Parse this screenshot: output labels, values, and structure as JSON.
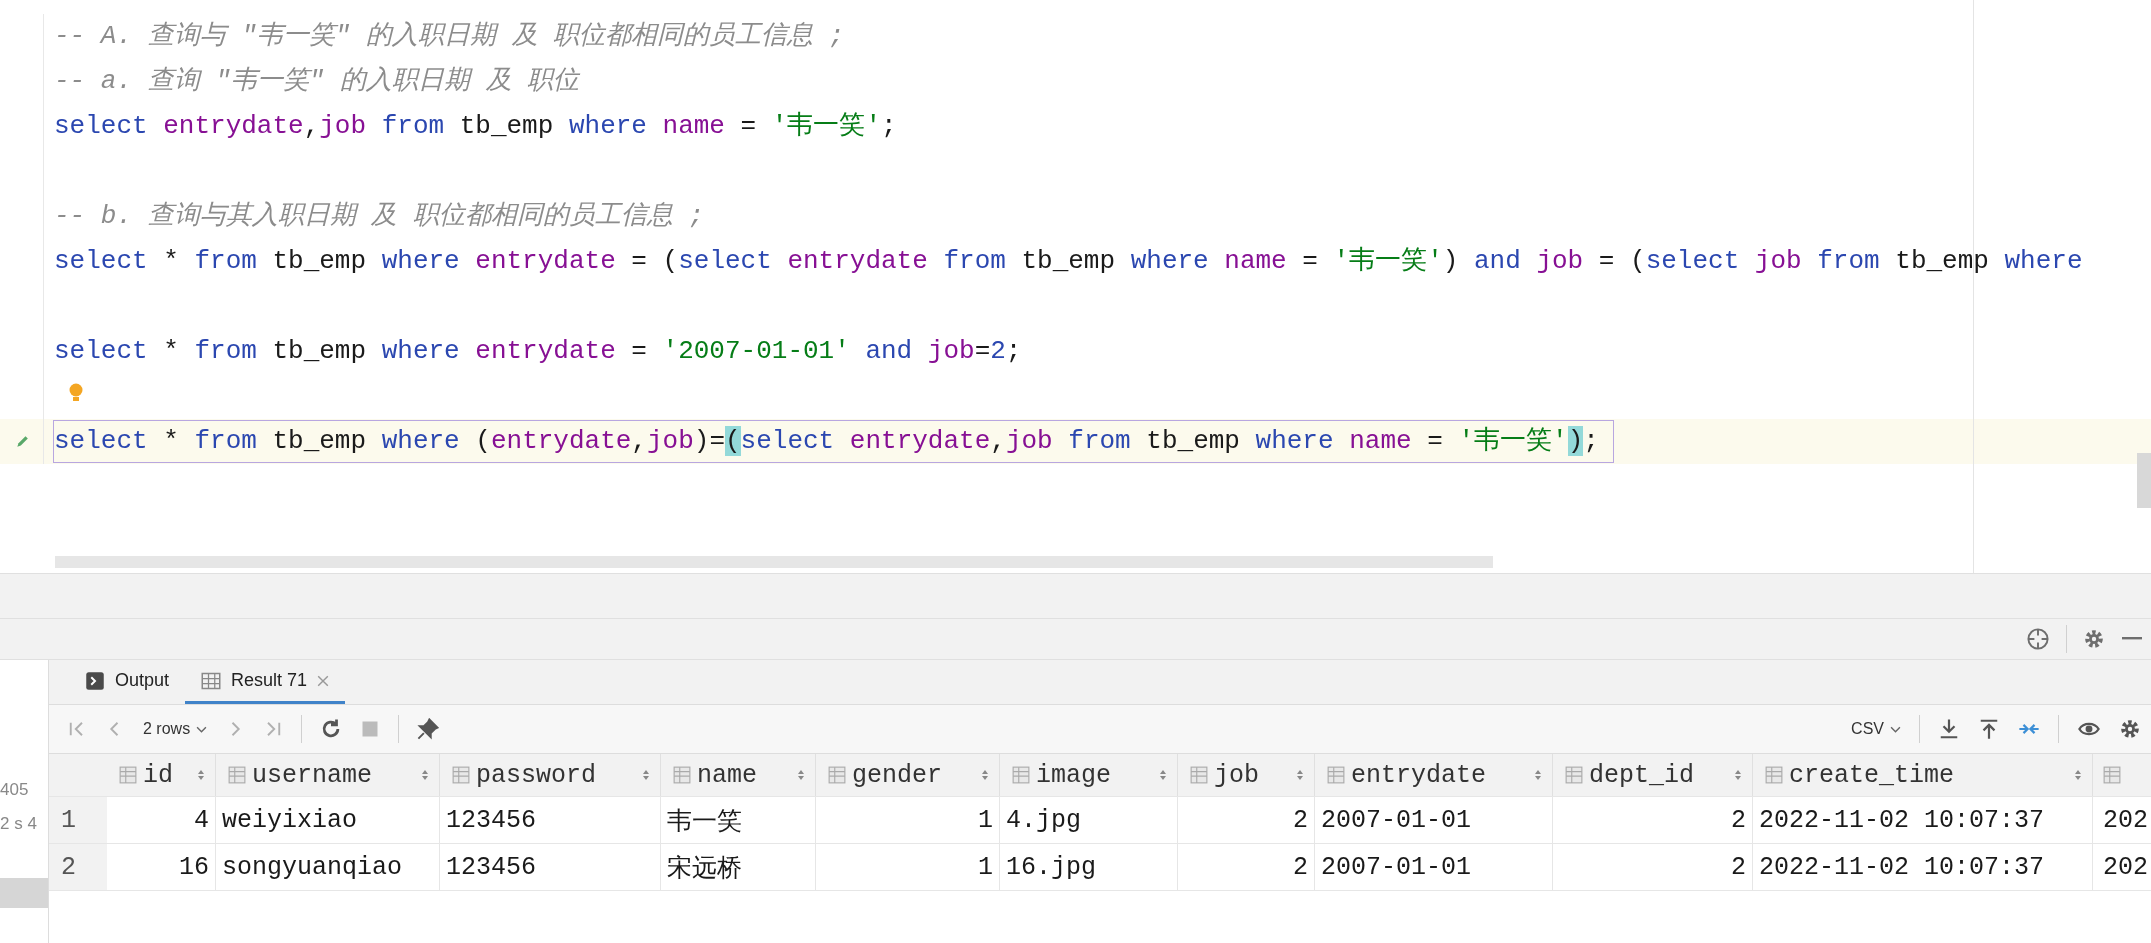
{
  "editor": {
    "intention_bulb": true,
    "lines": [
      {
        "kind": "code",
        "current": false,
        "tokens": [
          {
            "kind": "comment",
            "text": "-- A. 查询与 \"韦一笑\" 的入职日期 及 职位都相同的员工信息 ;"
          }
        ]
      },
      {
        "kind": "code",
        "current": false,
        "tokens": [
          {
            "kind": "comment",
            "text": "-- a. 查询 \"韦一笑\" 的入职日期 及 职位"
          }
        ]
      },
      {
        "kind": "code",
        "current": false,
        "tokens": [
          {
            "kind": "keyword",
            "text": "select "
          },
          {
            "kind": "column",
            "text": "entrydate"
          },
          {
            "kind": "plain",
            "text": ","
          },
          {
            "kind": "column",
            "text": "job "
          },
          {
            "kind": "keyword",
            "text": "from"
          },
          {
            "kind": "plain",
            "text": " tb_emp "
          },
          {
            "kind": "keyword",
            "text": "where "
          },
          {
            "kind": "column",
            "text": "name"
          },
          {
            "kind": "plain",
            "text": " = "
          },
          {
            "kind": "string",
            "text": "'韦一笑'"
          },
          {
            "kind": "plain",
            "text": ";"
          }
        ]
      },
      {
        "kind": "blank"
      },
      {
        "kind": "code",
        "current": false,
        "tokens": [
          {
            "kind": "comment",
            "text": "-- b. 查询与其入职日期 及 职位都相同的员工信息 ;"
          }
        ]
      },
      {
        "kind": "code",
        "current": false,
        "tokens": [
          {
            "kind": "keyword",
            "text": "select"
          },
          {
            "kind": "plain",
            "text": " * "
          },
          {
            "kind": "keyword",
            "text": "from"
          },
          {
            "kind": "plain",
            "text": " tb_emp "
          },
          {
            "kind": "keyword",
            "text": "where "
          },
          {
            "kind": "column",
            "text": "entrydate"
          },
          {
            "kind": "plain",
            "text": " = ("
          },
          {
            "kind": "keyword",
            "text": "select "
          },
          {
            "kind": "column",
            "text": "entrydate "
          },
          {
            "kind": "keyword",
            "text": "from"
          },
          {
            "kind": "plain",
            "text": " tb_emp "
          },
          {
            "kind": "keyword",
            "text": "where "
          },
          {
            "kind": "column",
            "text": "name"
          },
          {
            "kind": "plain",
            "text": " = "
          },
          {
            "kind": "string",
            "text": "'韦一笑'"
          },
          {
            "kind": "plain",
            "text": ") "
          },
          {
            "kind": "keyword",
            "text": "and "
          },
          {
            "kind": "column",
            "text": "job"
          },
          {
            "kind": "plain",
            "text": " = ("
          },
          {
            "kind": "keyword",
            "text": "select "
          },
          {
            "kind": "column",
            "text": "job "
          },
          {
            "kind": "keyword",
            "text": "from"
          },
          {
            "kind": "plain",
            "text": " tb_emp "
          },
          {
            "kind": "keyword",
            "text": "where"
          }
        ]
      },
      {
        "kind": "blank"
      },
      {
        "kind": "code",
        "current": false,
        "tokens": [
          {
            "kind": "keyword",
            "text": "select"
          },
          {
            "kind": "plain",
            "text": " * "
          },
          {
            "kind": "keyword",
            "text": "from"
          },
          {
            "kind": "plain",
            "text": " tb_emp "
          },
          {
            "kind": "keyword",
            "text": "where "
          },
          {
            "kind": "column",
            "text": "entrydate"
          },
          {
            "kind": "plain",
            "text": " = "
          },
          {
            "kind": "string",
            "text": "'2007-01-01'"
          },
          {
            "kind": "keyword",
            "text": " and "
          },
          {
            "kind": "column",
            "text": "job"
          },
          {
            "kind": "plain",
            "text": "="
          },
          {
            "kind": "number",
            "text": "2"
          },
          {
            "kind": "plain",
            "text": ";"
          }
        ]
      },
      {
        "kind": "blank"
      },
      {
        "kind": "code",
        "current": true,
        "tokens": [
          {
            "kind": "keyword",
            "text": "select"
          },
          {
            "kind": "plain",
            "text": " * "
          },
          {
            "kind": "keyword",
            "text": "from"
          },
          {
            "kind": "plain",
            "text": " tb_emp "
          },
          {
            "kind": "keyword",
            "text": "where"
          },
          {
            "kind": "plain",
            "text": " ("
          },
          {
            "kind": "column",
            "text": "entrydate"
          },
          {
            "kind": "plain",
            "text": ","
          },
          {
            "kind": "column",
            "text": "job"
          },
          {
            "kind": "plain",
            "text": ")="
          },
          {
            "kind": "match",
            "text": "("
          },
          {
            "kind": "keyword",
            "text": "select "
          },
          {
            "kind": "column",
            "text": "entrydate"
          },
          {
            "kind": "plain",
            "text": ","
          },
          {
            "kind": "column",
            "text": "job "
          },
          {
            "kind": "keyword",
            "text": "from"
          },
          {
            "kind": "plain",
            "text": " tb_emp "
          },
          {
            "kind": "keyword",
            "text": "where "
          },
          {
            "kind": "column",
            "text": "name"
          },
          {
            "kind": "plain",
            "text": " = "
          },
          {
            "kind": "string",
            "text": "'韦一笑'"
          },
          {
            "kind": "match",
            "text": ")"
          },
          {
            "kind": "plain",
            "text": ";"
          }
        ]
      }
    ]
  },
  "left_panel": {
    "lines": [
      "405",
      "2 s 4"
    ]
  },
  "results": {
    "tabs": [
      {
        "label": "Output",
        "kind": "console",
        "selected": false
      },
      {
        "label": "Result 71",
        "kind": "table",
        "selected": true
      }
    ],
    "rows_label": "2 rows",
    "export_format": "CSV",
    "columns": [
      {
        "label": "id",
        "kind": "number"
      },
      {
        "label": "username",
        "kind": "text"
      },
      {
        "label": "password",
        "kind": "text"
      },
      {
        "label": "name",
        "kind": "text"
      },
      {
        "label": "gender",
        "kind": "number"
      },
      {
        "label": "image",
        "kind": "text"
      },
      {
        "label": "job",
        "kind": "number"
      },
      {
        "label": "entrydate",
        "kind": "text"
      },
      {
        "label": "dept_id",
        "kind": "number"
      },
      {
        "label": "create_time",
        "kind": "text"
      }
    ],
    "rows": [
      {
        "number": "1",
        "cells": [
          "4",
          "weiyixiao",
          "123456",
          "韦一笑",
          "1",
          "4.jpg",
          "2",
          "2007-01-01",
          "2",
          "2022-11-02 10:07:37"
        ],
        "cut_cell": "202"
      },
      {
        "number": "2",
        "cells": [
          "16",
          "songyuanqiao",
          "123456",
          "宋远桥",
          "1",
          "16.jpg",
          "2",
          "2007-01-01",
          "2",
          "2022-11-02 10:07:37"
        ],
        "cut_cell": "202"
      }
    ]
  }
}
